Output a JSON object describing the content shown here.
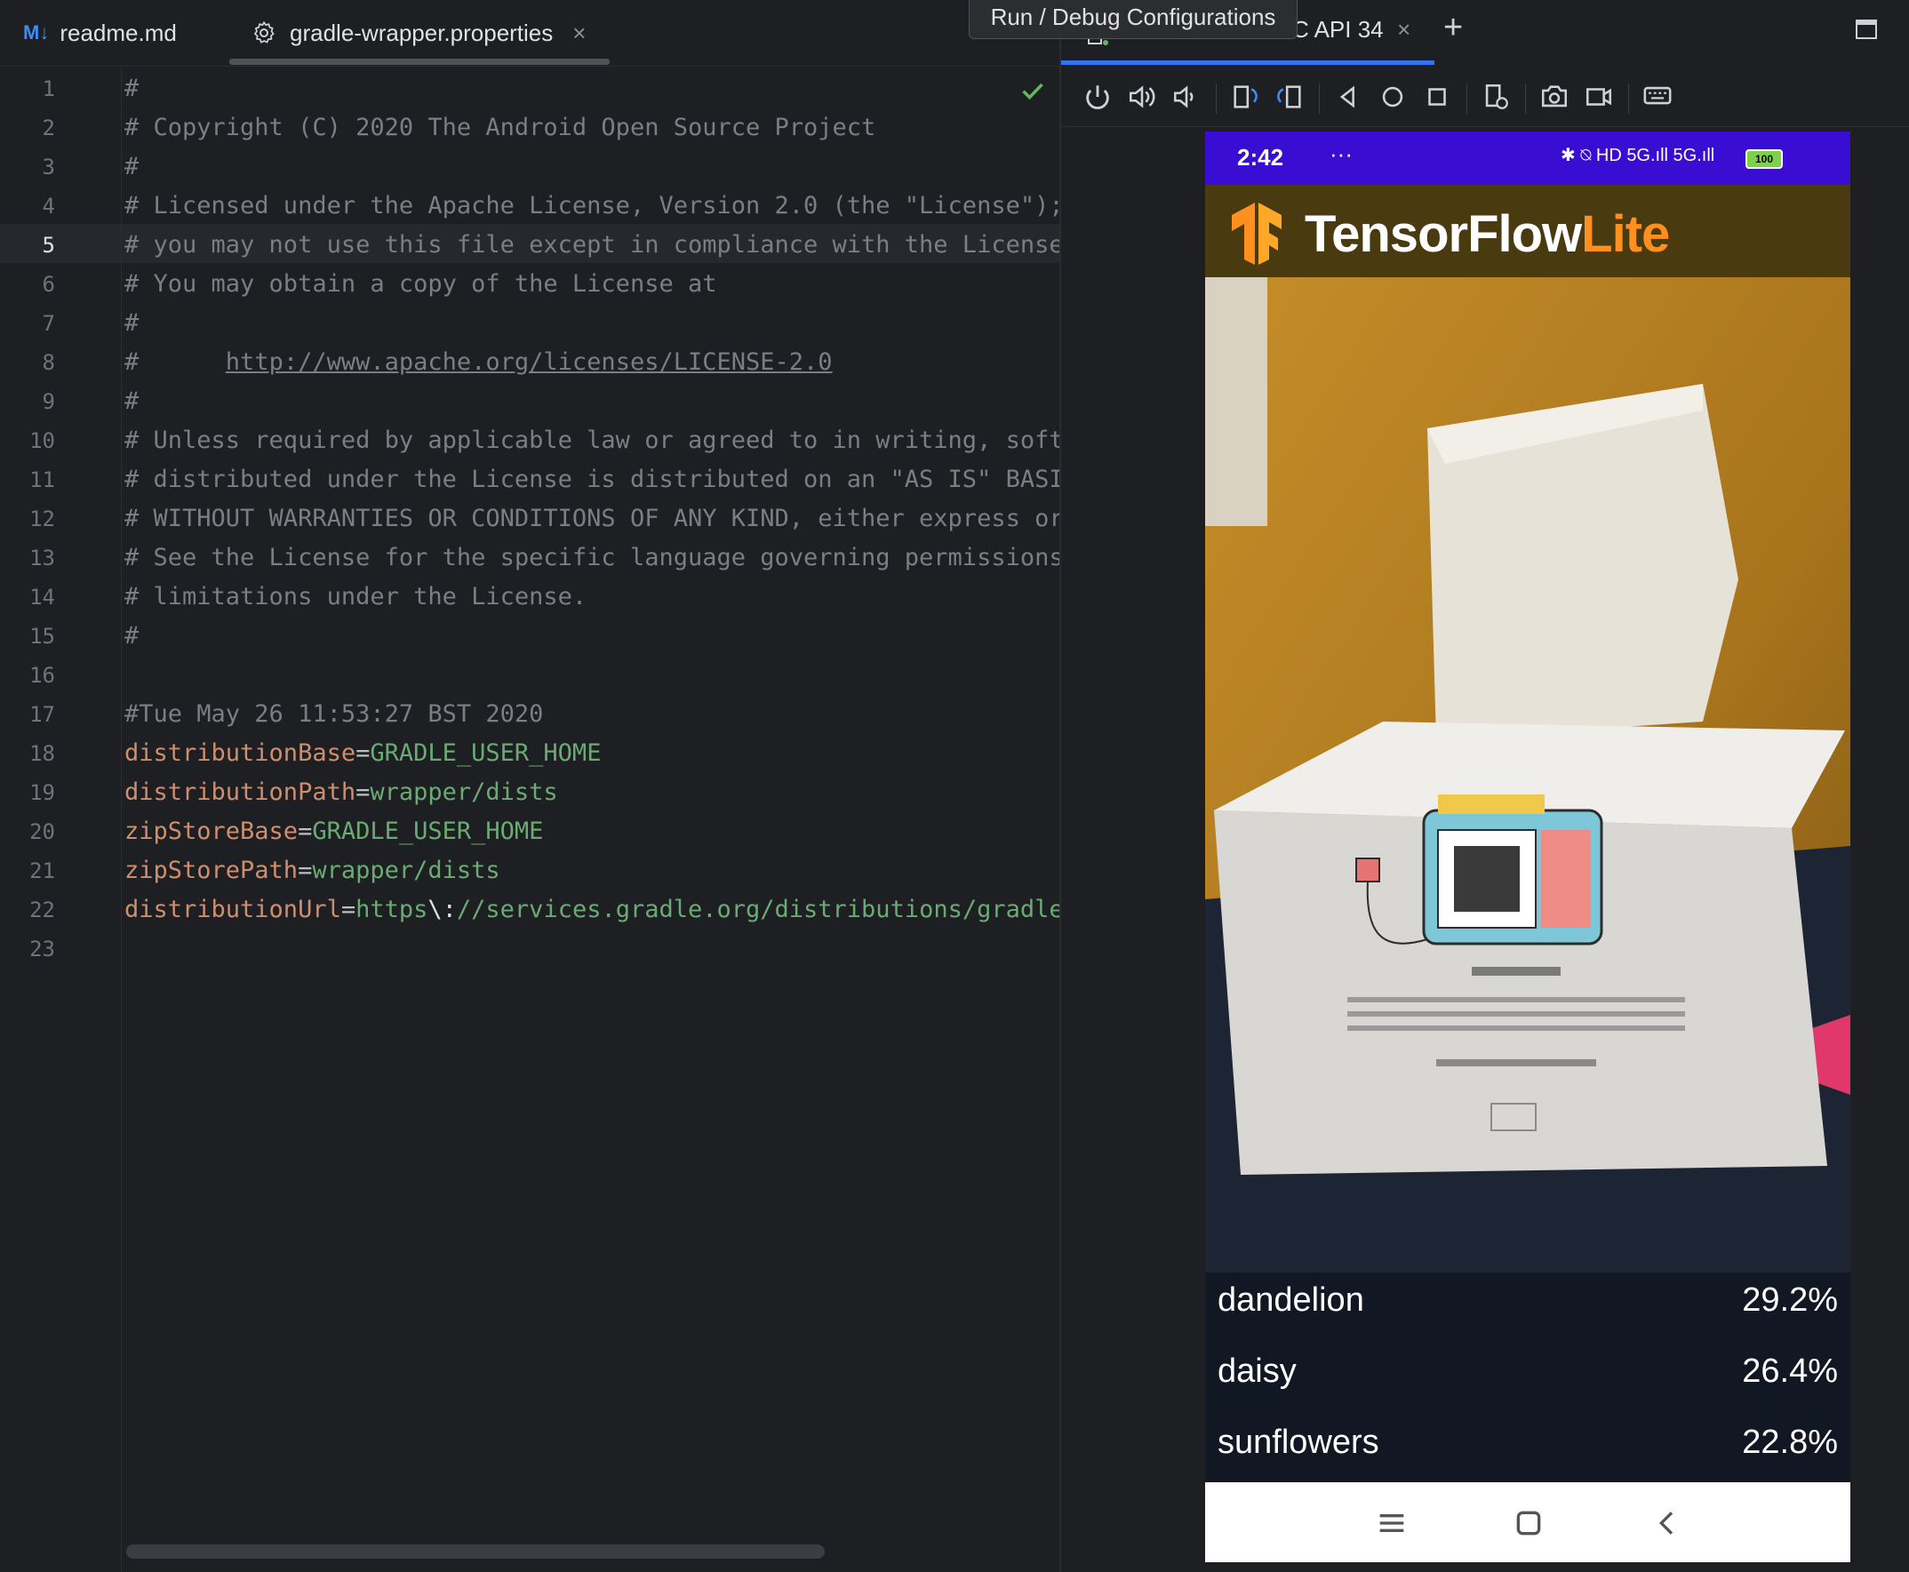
{
  "editor": {
    "tabs": [
      {
        "icon": "M↓",
        "label": "readme.md"
      },
      {
        "label": "gradle-wrapper.properties",
        "close": "×"
      }
    ],
    "line_numbers": [
      "1",
      "2",
      "3",
      "4",
      "5",
      "6",
      "7",
      "8",
      "9",
      "10",
      "11",
      "12",
      "13",
      "14",
      "15",
      "16",
      "17",
      "18",
      "19",
      "20",
      "21",
      "22",
      "23"
    ],
    "current_line": "5",
    "lines": {
      "l1": "#",
      "l2": "# Copyright (C) 2020 The Android Open Source Project",
      "l3": "#",
      "l4": "# Licensed under the Apache License, Version 2.0 (the \"License\");",
      "l5": "# you may not use this file except in compliance with the License.",
      "l6": "# You may obtain a copy of the License at",
      "l7": "#",
      "l8_prefix": "#      ",
      "l8_link": "http://www.apache.org/licenses/LICENSE-2.0",
      "l9": "#",
      "l10": "# Unless required by applicable law or agreed to in writing, softw",
      "l11": "# distributed under the License is distributed on an \"AS IS\" BASIS",
      "l12": "# WITHOUT WARRANTIES OR CONDITIONS OF ANY KIND, either express or",
      "l13": "# See the License for the specific language governing permissions",
      "l14": "# limitations under the License.",
      "l15": "#",
      "l17": "#Tue May 26 11:53:27 BST 2020",
      "l18_key": "distributionBase",
      "l18_val": "GRADLE_USER_HOME",
      "l19_key": "distributionPath",
      "l19_val": "wrapper/dists",
      "l20_key": "zipStoreBase",
      "l20_val": "GRADLE_USER_HOME",
      "l21_key": "zipStorePath",
      "l21_val": "wrapper/dists",
      "l22_key": "distributionUrl",
      "l22_val_a": "https",
      "l22_esc": "\\:",
      "l22_val_b": "//services.gradle.org/distributions/gradle-",
      "eq": "="
    }
  },
  "device_panel": {
    "tooltip": "Run / Debug Configurations",
    "tab_label": "C API 34",
    "tab_close": "×",
    "add_tab": "+"
  },
  "phone": {
    "status_time": "2:42",
    "status_dots": "···",
    "status_right": "✱ ⍉ HD 5G.ıll 5G.ıll",
    "battery": "100",
    "app_title_main": "TensorFlow",
    "app_title_accent": "Lite",
    "results": [
      {
        "label": "dandelion",
        "score": "29.2%"
      },
      {
        "label": "daisy",
        "score": "26.4%"
      },
      {
        "label": "sunflowers",
        "score": "22.8%"
      }
    ],
    "colors": {
      "status_bar": "#3a0ed2",
      "accent": "#ff8f1f",
      "results_bg": "#111723"
    }
  }
}
